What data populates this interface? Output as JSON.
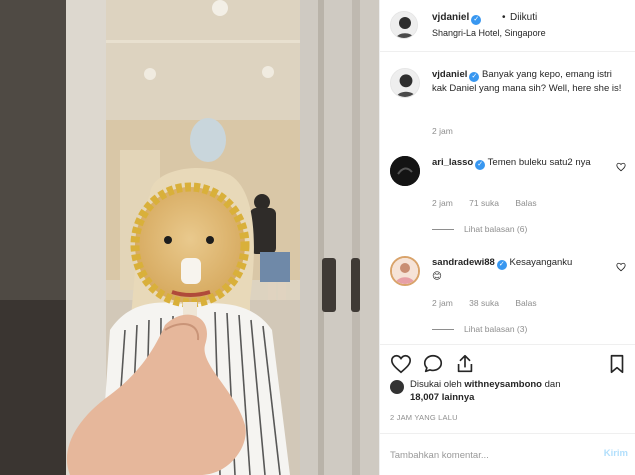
{
  "header": {
    "username": "vjdaniel",
    "separator": "•",
    "follow_label": "Diikuti",
    "location": "Shangri-La Hotel, Singapore"
  },
  "caption": {
    "username": "vjdaniel",
    "text": "Banyak yang kepo, emang istri kak Daniel yang mana sih? Well, here she is!",
    "time": "2 jam"
  },
  "comments": [
    {
      "username": "ari_lasso",
      "text": "Temen buleku satu2 nya",
      "time": "2 jam",
      "likes": "71 suka",
      "reply_label": "Balas",
      "view_replies": "Lihat balasan (6)"
    },
    {
      "username": "sandradewi88",
      "text": "Kesayanganku",
      "emoji": "😊",
      "time": "2 jam",
      "likes": "38 suka",
      "reply_label": "Balas",
      "view_replies": "Lihat balasan (3)"
    }
  ],
  "liked_by": {
    "prefix": "Disukai oleh",
    "user": "withneysambono",
    "joiner": "dan",
    "count": "18,007 lainnya"
  },
  "timestamp": "2 JAM YANG LALU",
  "comment_box": {
    "placeholder": "Tambahkan komentar...",
    "post_label": "Kirim"
  },
  "icons": {
    "verified": "verified-badge-icon",
    "like": "heart-icon",
    "comment": "comment-bubble-icon",
    "share": "share-icon",
    "bookmark": "bookmark-icon"
  },
  "colors": {
    "verified_blue": "#3897f0",
    "text": "#262626",
    "muted": "#8e8e8e",
    "post_button_disabled": "#b2dffc"
  }
}
